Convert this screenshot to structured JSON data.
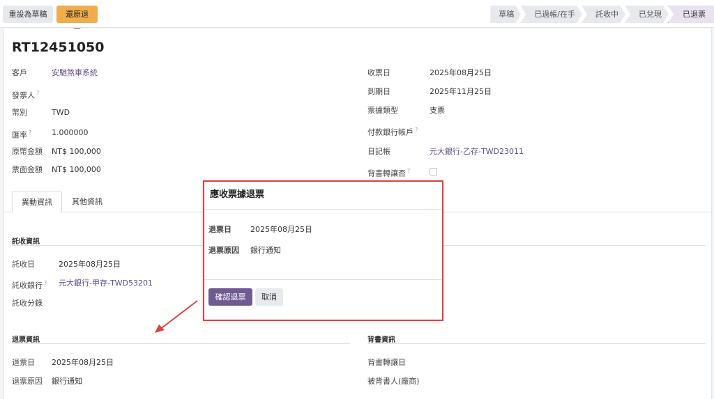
{
  "header": {
    "reset_draft_label": "重設為草稿",
    "return_ticket_label": "還原退票"
  },
  "statusbar": {
    "steps": [
      "草稿",
      "已過帳/在手",
      "託收中",
      "已兌現",
      "已退票"
    ],
    "active": "已退票"
  },
  "record": {
    "title": "RT12451050",
    "left_fields": [
      {
        "label": "客戶",
        "value": "安馳煞車系統"
      },
      {
        "label": "發票人",
        "value": ""
      },
      {
        "label": "幣別",
        "value": "TWD"
      },
      {
        "label": "匯率",
        "value": "1.000000"
      },
      {
        "label": "原幣金額",
        "value": "NT$ 100,000"
      },
      {
        "label": "票面金額",
        "value": "NT$ 100,000"
      }
    ],
    "right_fields": [
      {
        "label": "收票日",
        "value": "2025年08月25日"
      },
      {
        "label": "到期日",
        "value": "2025年11月25日"
      },
      {
        "label": "票據類型",
        "value": "支票"
      },
      {
        "label": "付款銀行帳戶",
        "value": ""
      },
      {
        "label": "日記帳",
        "value": "元大銀行-乙存-TWD23011"
      },
      {
        "label": "背書轉讓否",
        "value": ""
      }
    ]
  },
  "tabs": {
    "active_label": "異動資訊",
    "other_label": "其他資訊"
  },
  "collection": {
    "section_title": "託收資訊",
    "fields": [
      {
        "label": "託收日",
        "value": "2025年08月25日"
      },
      {
        "label": "託收銀行",
        "value": "元大銀行-甲存-TWD53201"
      },
      {
        "label": "託收分錄",
        "value": ""
      }
    ]
  },
  "bounce": {
    "section_title": "退票資訊",
    "fields": [
      {
        "label": "退票日",
        "value": "2025年08月25日"
      },
      {
        "label": "退票原因",
        "value": "銀行通知"
      }
    ]
  },
  "endorse": {
    "section_title": "背書資訊",
    "fields": [
      {
        "label": "背書轉讓日",
        "value": ""
      },
      {
        "label": "被背書人(廠商)",
        "value": ""
      }
    ]
  },
  "modal": {
    "title": "應收票據退票",
    "date_label": "退票日",
    "date_value": "2025年08月25日",
    "reason_label": "退票原因",
    "reason_value": "銀行通知",
    "confirm_label": "確認退票",
    "cancel_label": "取消"
  },
  "colors": {
    "primary": "#6f5b92",
    "warning": "#f0ad4e",
    "highlight_border": "#e04040",
    "link": "#5c4a86"
  }
}
